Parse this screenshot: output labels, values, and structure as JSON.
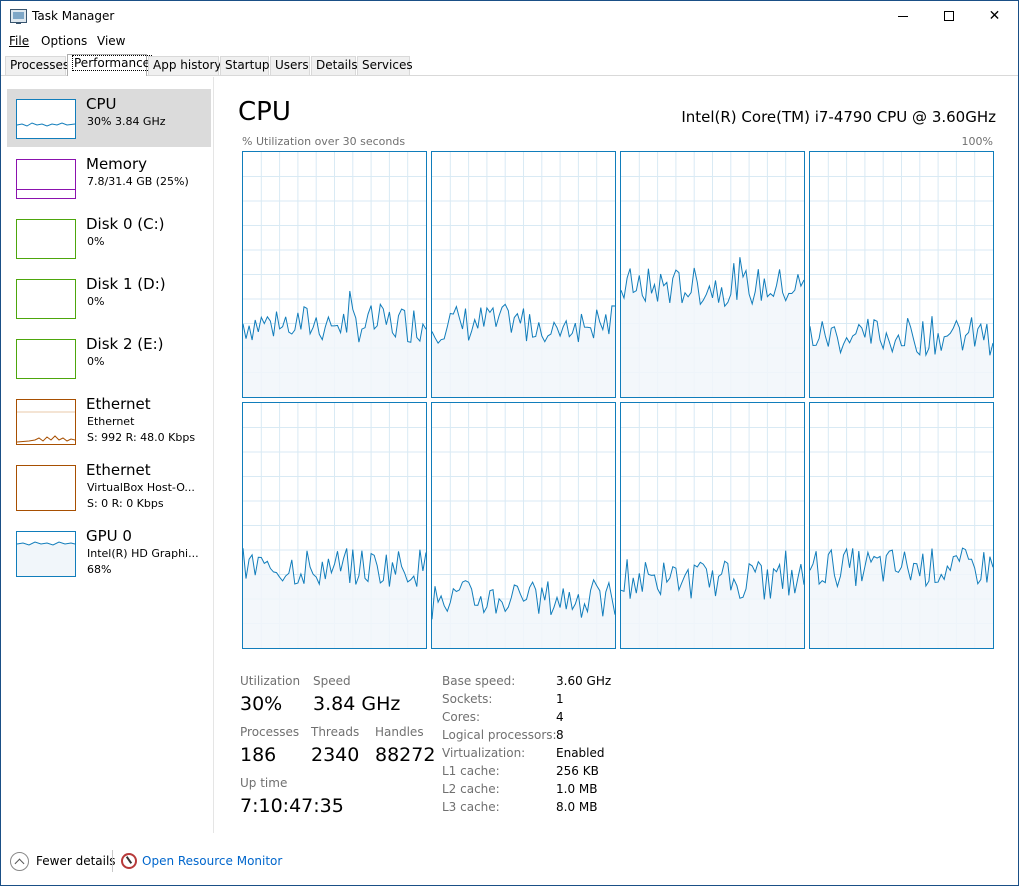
{
  "window": {
    "title": "Task Manager"
  },
  "menu": [
    "File",
    "Options",
    "View"
  ],
  "tabs": [
    "Processes",
    "Performance",
    "App history",
    "Startup",
    "Users",
    "Details",
    "Services"
  ],
  "active_tab": "Performance",
  "sidebar": [
    {
      "name": "CPU",
      "sub1": "30%  3.84 GHz",
      "color": "#117dbb",
      "selected": true
    },
    {
      "name": "Memory",
      "sub1": "7.8/31.4 GB (25%)",
      "color": "#8b12ae"
    },
    {
      "name": "Disk 0 (C:)",
      "sub1": "0%",
      "color": "#4da60c"
    },
    {
      "name": "Disk 1 (D:)",
      "sub1": "0%",
      "color": "#4da60c"
    },
    {
      "name": "Disk 2 (E:)",
      "sub1": "0%",
      "color": "#4da60c"
    },
    {
      "name": "Ethernet",
      "sub1": "Ethernet",
      "sub2": "S: 992  R: 48.0 Kbps",
      "color": "#a74f01"
    },
    {
      "name": "Ethernet",
      "sub1": "VirtualBox Host-O...",
      "sub2": "S: 0  R: 0 Kbps",
      "color": "#a74f01"
    },
    {
      "name": "GPU 0",
      "sub1": "Intel(R) HD Graphi...",
      "sub2": "68%",
      "color": "#117dbb"
    }
  ],
  "main": {
    "title": "CPU",
    "model": "Intel(R) Core(TM) i7-4790 CPU @ 3.60GHz",
    "axis_left": "% Utilization over 30 seconds",
    "axis_right": "100%",
    "core_levels": [
      0.3,
      0.3,
      0.45,
      0.25,
      0.33,
      0.2,
      0.28,
      0.33
    ]
  },
  "stats": {
    "utilization_label": "Utilization",
    "utilization": "30%",
    "speed_label": "Speed",
    "speed": "3.84 GHz",
    "processes_label": "Processes",
    "processes": "186",
    "threads_label": "Threads",
    "threads": "2340",
    "handles_label": "Handles",
    "handles": "88272",
    "uptime_label": "Up time",
    "uptime": "7:10:47:35"
  },
  "info": [
    {
      "label": "Base speed:",
      "value": "3.60 GHz"
    },
    {
      "label": "Sockets:",
      "value": "1"
    },
    {
      "label": "Cores:",
      "value": "4"
    },
    {
      "label": "Logical processors:",
      "value": "8"
    },
    {
      "label": "Virtualization:",
      "value": "Enabled"
    },
    {
      "label": "L1 cache:",
      "value": "256 KB"
    },
    {
      "label": "L2 cache:",
      "value": "1.0 MB"
    },
    {
      "label": "L3 cache:",
      "value": "8.0 MB"
    }
  ],
  "footer": {
    "fewer": "Fewer details",
    "resource": "Open Resource Monitor"
  },
  "colors": {
    "cpu_line": "#117dbb",
    "cpu_fill": "#f1f6fa",
    "grid": "#d9eaf4"
  }
}
